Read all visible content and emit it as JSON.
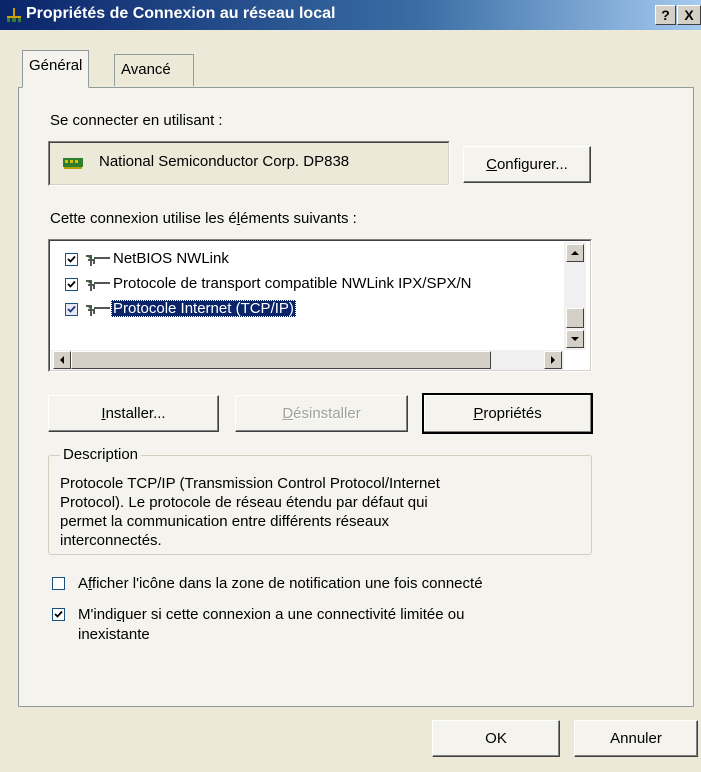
{
  "window": {
    "title": "Propriétés de Connexion au réseau local",
    "help_btn": "?",
    "close_btn": "X"
  },
  "tabs": [
    {
      "label": "Général",
      "active": true
    },
    {
      "label": "Avancé",
      "active": false
    }
  ],
  "general": {
    "connect_using_label": "Se connecter en utilisant :",
    "adapter_name": "National Semiconductor Corp. DP838",
    "configure_btn_u": "C",
    "configure_btn_rest": "onfigurer...",
    "items_label_pre": "Cette connexion utilise les é",
    "items_label_u": "l",
    "items_label_post": "éments suivants :",
    "items": [
      {
        "label": "NetBIOS NWLink",
        "checked": true,
        "selected": false
      },
      {
        "label": "Protocole de transport compatible NWLink IPX/SPX/N",
        "checked": true,
        "selected": false
      },
      {
        "label": "Protocole Internet (TCP/IP)",
        "checked": true,
        "selected": true
      }
    ],
    "install_btn_u": "I",
    "install_btn_rest": "nstaller...",
    "uninstall_btn_u": "D",
    "uninstall_btn_rest": "ésinstaller",
    "properties_btn_u": "P",
    "properties_btn_rest": "ropriétés",
    "description_title": "Description",
    "description_lines": [
      "Protocole TCP/IP (Transmission Control Protocol/Internet",
      "Protocol). Le protocole de réseau étendu par défaut qui",
      "permet la communication entre différents réseaux",
      "interconnectés."
    ],
    "show_icon_pre": "A",
    "show_icon_u": "f",
    "show_icon_post": "ficher l'icône dans la zone de notification une fois connecté",
    "show_icon_checked": false,
    "notify_pre": "M'indi",
    "notify_u": "q",
    "notify_post": "uer si cette connexion a une connectivité limitée ou",
    "notify_line2": "inexistante",
    "notify_checked": true
  },
  "footer": {
    "ok_btn": "OK",
    "cancel_btn": "Annuler"
  },
  "colors": {
    "title_start": "#0a246a",
    "title_end": "#a6caf0",
    "selection": "#0a246a",
    "dialog_bg": "#ece9d8",
    "panel_bg": "#f4f3ee"
  }
}
